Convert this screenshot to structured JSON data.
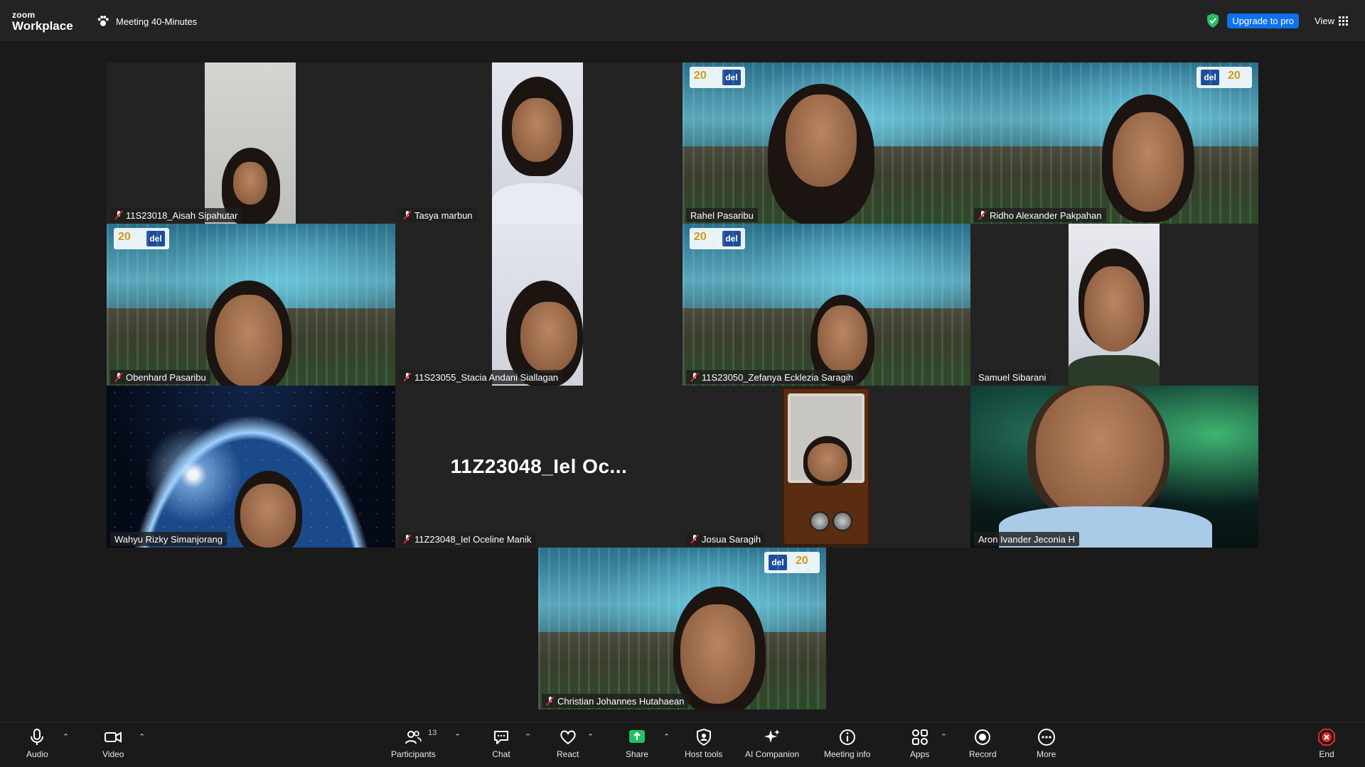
{
  "app": {
    "brand_small": "zoom",
    "brand_name": "Workplace"
  },
  "meeting": {
    "title": "Meeting 40-Minutes"
  },
  "topbar": {
    "upgrade_label": "Upgrade to pro",
    "view_label": "View"
  },
  "participants": [
    {
      "name": "11S23018_Aisah Sipahutar",
      "muted": true
    },
    {
      "name": "Tasya marbun",
      "muted": true
    },
    {
      "name": "Rahel Pasaribu",
      "muted": false
    },
    {
      "name": "Ridho Alexander Pakpahan",
      "muted": true
    },
    {
      "name": "Obenhard Pasaribu",
      "muted": true
    },
    {
      "name": "11S23055_Stacia Andani Siallagan",
      "muted": true
    },
    {
      "name": "11S23050_Zefanya Ecklezia Saragih",
      "muted": true
    },
    {
      "name": "Samuel Sibarani",
      "muted": false
    },
    {
      "name": "Wahyu Rizky Simanjorang",
      "muted": false,
      "active_speaker": true
    },
    {
      "name": "11Z23048_Iel Oceline Manik",
      "muted": true,
      "video_off_label": "11Z23048_Iel  Oc..."
    },
    {
      "name": "Josua Saragih",
      "muted": true
    },
    {
      "name": "Aron Ivander Jeconia H",
      "muted": false
    },
    {
      "name": "Christian Johannes Hutahaean",
      "muted": true
    }
  ],
  "toolbar": {
    "audio": "Audio",
    "video": "Video",
    "participants": "Participants",
    "participants_count": "13",
    "chat": "Chat",
    "react": "React",
    "share": "Share",
    "host_tools": "Host tools",
    "ai_companion": "AI Companion",
    "meeting_info": "Meeting info",
    "apps": "Apps",
    "record": "Record",
    "more": "More",
    "end": "End"
  },
  "colors": {
    "accent_blue": "#0e72ed",
    "active_speaker_border": "#24c063",
    "share_green": "#24c063",
    "end_red": "#e02828"
  }
}
